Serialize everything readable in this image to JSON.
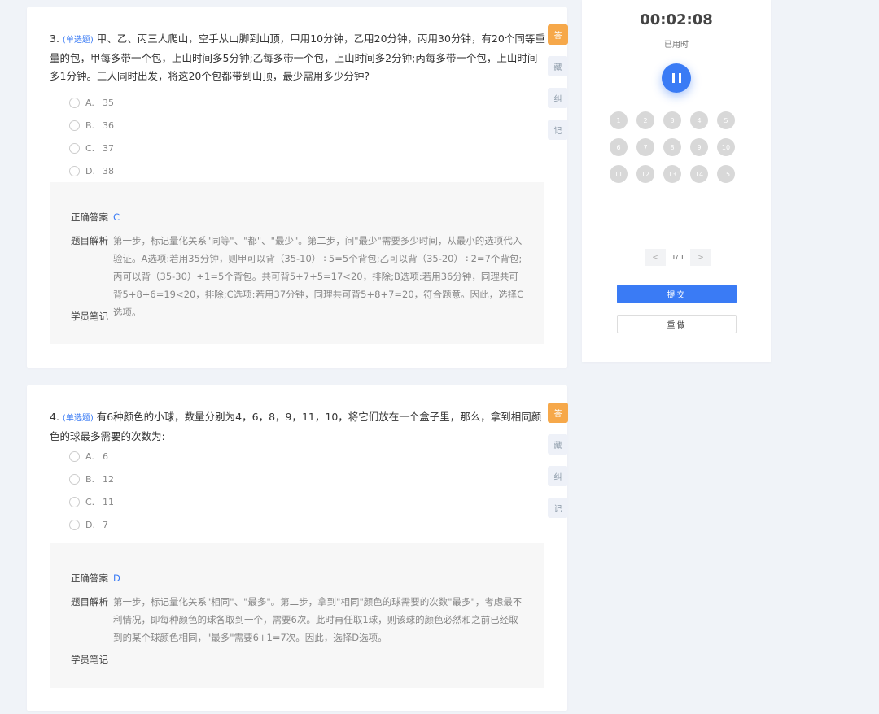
{
  "questions": [
    {
      "number": "3.",
      "type": "(单选题)",
      "stem": "(单选题)甲、乙、丙三人爬山，空手从山脚到山顶，甲用10分钟，乙用20分钟，丙用30分钟，有20个同等重量的包，甲每多带一个包，上山时间多5分钟;乙每多带一个包，上山时间多2分钟;丙每多带一个包，上山时间多1分钟。三人同时出发，将这20个包都带到山顶，最少需用多少分钟?",
      "options": [
        {
          "letter": "A.",
          "value": "35"
        },
        {
          "letter": "B.",
          "value": "36"
        },
        {
          "letter": "C.",
          "value": "37"
        },
        {
          "letter": "D.",
          "value": "38"
        }
      ],
      "answer_label": "正确答案",
      "answer": "C",
      "analysis_label": "题目解析",
      "analysis": "第一步，标记量化关系\"同等\"、\"都\"、\"最少\"。第二步，问\"最少\"需要多少时间，从最小的选项代入验证。A选项:若用35分钟，则甲可以背（35-10）÷5=5个背包;乙可以背（35-20）÷2=7个背包;丙可以背（35-30）÷1=5个背包。共可背5+7+5=17<20，排除;B选项:若用36分钟，同理共可背5+8+6=19<20，排除;C选项:若用37分钟，同理共可背5+8+7=20，符合题意。因此，选择C选项。",
      "notes_label": "学员笔记"
    },
    {
      "number": "4.",
      "type": "(单选题)",
      "stem": "(单选题)有6种颜色的小球，数量分别为4，6，8，9，11，10，将它们放在一个盒子里，那么，拿到相同颜色的球最多需要的次数为:",
      "options": [
        {
          "letter": "A.",
          "value": "6"
        },
        {
          "letter": "B.",
          "value": "12"
        },
        {
          "letter": "C.",
          "value": "11"
        },
        {
          "letter": "D.",
          "value": "7"
        }
      ],
      "answer_label": "正确答案",
      "answer": "D",
      "analysis_label": "题目解析",
      "analysis": "第一步，标记量化关系\"相同\"、\"最多\"。第二步，拿到\"相同\"颜色的球需要的次数\"最多\"，考虑最不利情况，即每种颜色的球各取到一个，需要6次。此时再任取1球，则该球的颜色必然和之前已经取到的某个球颜色相同，\"最多\"需要6+1=7次。因此，选择D选项。",
      "notes_label": "学员笔记"
    }
  ],
  "side_buttons": [
    "答",
    "藏",
    "纠",
    "记"
  ],
  "panel": {
    "timer": "00:02:08",
    "timer_label": "已用时",
    "numbers": [
      "1",
      "2",
      "3",
      "4",
      "5",
      "6",
      "7",
      "8",
      "9",
      "10",
      "11",
      "12",
      "13",
      "14",
      "15"
    ],
    "pager": {
      "prev": "<",
      "text": "1/ 1",
      "next": ">"
    },
    "submit": "提交",
    "redo": "重做"
  },
  "colors": {
    "accent": "#3a7bf5",
    "orange": "#f6a84a"
  }
}
